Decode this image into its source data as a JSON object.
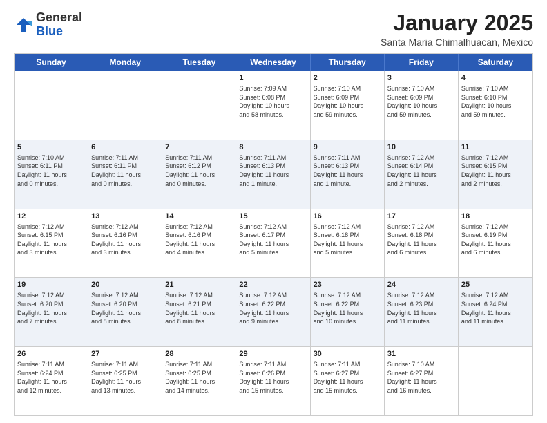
{
  "logo": {
    "general": "General",
    "blue": "Blue"
  },
  "header": {
    "month": "January 2025",
    "location": "Santa Maria Chimalhuacan, Mexico"
  },
  "days": [
    "Sunday",
    "Monday",
    "Tuesday",
    "Wednesday",
    "Thursday",
    "Friday",
    "Saturday"
  ],
  "weeks": [
    [
      {
        "day": "",
        "info": ""
      },
      {
        "day": "",
        "info": ""
      },
      {
        "day": "",
        "info": ""
      },
      {
        "day": "1",
        "info": "Sunrise: 7:09 AM\nSunset: 6:08 PM\nDaylight: 10 hours\nand 58 minutes."
      },
      {
        "day": "2",
        "info": "Sunrise: 7:10 AM\nSunset: 6:09 PM\nDaylight: 10 hours\nand 59 minutes."
      },
      {
        "day": "3",
        "info": "Sunrise: 7:10 AM\nSunset: 6:09 PM\nDaylight: 10 hours\nand 59 minutes."
      },
      {
        "day": "4",
        "info": "Sunrise: 7:10 AM\nSunset: 6:10 PM\nDaylight: 10 hours\nand 59 minutes."
      }
    ],
    [
      {
        "day": "5",
        "info": "Sunrise: 7:10 AM\nSunset: 6:11 PM\nDaylight: 11 hours\nand 0 minutes."
      },
      {
        "day": "6",
        "info": "Sunrise: 7:11 AM\nSunset: 6:11 PM\nDaylight: 11 hours\nand 0 minutes."
      },
      {
        "day": "7",
        "info": "Sunrise: 7:11 AM\nSunset: 6:12 PM\nDaylight: 11 hours\nand 0 minutes."
      },
      {
        "day": "8",
        "info": "Sunrise: 7:11 AM\nSunset: 6:13 PM\nDaylight: 11 hours\nand 1 minute."
      },
      {
        "day": "9",
        "info": "Sunrise: 7:11 AM\nSunset: 6:13 PM\nDaylight: 11 hours\nand 1 minute."
      },
      {
        "day": "10",
        "info": "Sunrise: 7:12 AM\nSunset: 6:14 PM\nDaylight: 11 hours\nand 2 minutes."
      },
      {
        "day": "11",
        "info": "Sunrise: 7:12 AM\nSunset: 6:15 PM\nDaylight: 11 hours\nand 2 minutes."
      }
    ],
    [
      {
        "day": "12",
        "info": "Sunrise: 7:12 AM\nSunset: 6:15 PM\nDaylight: 11 hours\nand 3 minutes."
      },
      {
        "day": "13",
        "info": "Sunrise: 7:12 AM\nSunset: 6:16 PM\nDaylight: 11 hours\nand 3 minutes."
      },
      {
        "day": "14",
        "info": "Sunrise: 7:12 AM\nSunset: 6:16 PM\nDaylight: 11 hours\nand 4 minutes."
      },
      {
        "day": "15",
        "info": "Sunrise: 7:12 AM\nSunset: 6:17 PM\nDaylight: 11 hours\nand 5 minutes."
      },
      {
        "day": "16",
        "info": "Sunrise: 7:12 AM\nSunset: 6:18 PM\nDaylight: 11 hours\nand 5 minutes."
      },
      {
        "day": "17",
        "info": "Sunrise: 7:12 AM\nSunset: 6:18 PM\nDaylight: 11 hours\nand 6 minutes."
      },
      {
        "day": "18",
        "info": "Sunrise: 7:12 AM\nSunset: 6:19 PM\nDaylight: 11 hours\nand 6 minutes."
      }
    ],
    [
      {
        "day": "19",
        "info": "Sunrise: 7:12 AM\nSunset: 6:20 PM\nDaylight: 11 hours\nand 7 minutes."
      },
      {
        "day": "20",
        "info": "Sunrise: 7:12 AM\nSunset: 6:20 PM\nDaylight: 11 hours\nand 8 minutes."
      },
      {
        "day": "21",
        "info": "Sunrise: 7:12 AM\nSunset: 6:21 PM\nDaylight: 11 hours\nand 8 minutes."
      },
      {
        "day": "22",
        "info": "Sunrise: 7:12 AM\nSunset: 6:22 PM\nDaylight: 11 hours\nand 9 minutes."
      },
      {
        "day": "23",
        "info": "Sunrise: 7:12 AM\nSunset: 6:22 PM\nDaylight: 11 hours\nand 10 minutes."
      },
      {
        "day": "24",
        "info": "Sunrise: 7:12 AM\nSunset: 6:23 PM\nDaylight: 11 hours\nand 11 minutes."
      },
      {
        "day": "25",
        "info": "Sunrise: 7:12 AM\nSunset: 6:24 PM\nDaylight: 11 hours\nand 11 minutes."
      }
    ],
    [
      {
        "day": "26",
        "info": "Sunrise: 7:11 AM\nSunset: 6:24 PM\nDaylight: 11 hours\nand 12 minutes."
      },
      {
        "day": "27",
        "info": "Sunrise: 7:11 AM\nSunset: 6:25 PM\nDaylight: 11 hours\nand 13 minutes."
      },
      {
        "day": "28",
        "info": "Sunrise: 7:11 AM\nSunset: 6:25 PM\nDaylight: 11 hours\nand 14 minutes."
      },
      {
        "day": "29",
        "info": "Sunrise: 7:11 AM\nSunset: 6:26 PM\nDaylight: 11 hours\nand 15 minutes."
      },
      {
        "day": "30",
        "info": "Sunrise: 7:11 AM\nSunset: 6:27 PM\nDaylight: 11 hours\nand 15 minutes."
      },
      {
        "day": "31",
        "info": "Sunrise: 7:10 AM\nSunset: 6:27 PM\nDaylight: 11 hours\nand 16 minutes."
      },
      {
        "day": "",
        "info": ""
      }
    ]
  ]
}
